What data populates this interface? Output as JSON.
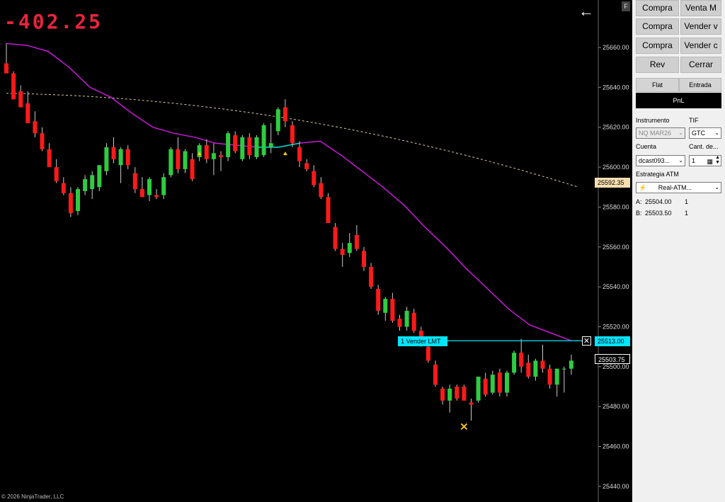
{
  "chart": {
    "pnl_display": "-402.25",
    "copyright": "© 2026 NinjaTrader, LLC",
    "y_ticks": [
      "25660.00",
      "25640.00",
      "25620.00",
      "25600.00",
      "25580.00",
      "25560.00",
      "25540.00",
      "25520.00",
      "25500.00",
      "25480.00",
      "25460.00",
      "25440.00"
    ],
    "price_tags": {
      "dashed_ma": "25592.35",
      "order": "25513.00",
      "last": "25503.75"
    },
    "order_label": "1  Vender LMT",
    "colors": {
      "bull": "#2ecc40",
      "bear": "#ff1a1a",
      "ma_fast": "#c818d8",
      "ma_fast_tail": "#00e5e5",
      "ma_slow": "#d9c9a0",
      "order_line": "#00e5ff"
    }
  },
  "chart_data": {
    "type": "candlestick",
    "ylim": [
      25434,
      25670
    ],
    "candles": [
      {
        "o": 25652,
        "h": 25662,
        "l": 25647,
        "c": 25647
      },
      {
        "o": 25647,
        "h": 25648,
        "l": 25634,
        "c": 25634
      },
      {
        "o": 25638,
        "h": 25641,
        "l": 25630,
        "c": 25630
      },
      {
        "o": 25632,
        "h": 25638,
        "l": 25622,
        "c": 25622
      },
      {
        "o": 25623,
        "h": 25628,
        "l": 25615,
        "c": 25617
      },
      {
        "o": 25617,
        "h": 25620,
        "l": 25608,
        "c": 25609
      },
      {
        "o": 25609,
        "h": 25612,
        "l": 25600,
        "c": 25600
      },
      {
        "o": 25600,
        "h": 25604,
        "l": 25592,
        "c": 25593
      },
      {
        "o": 25592,
        "h": 25595,
        "l": 25586,
        "c": 25587
      },
      {
        "o": 25587,
        "h": 25590,
        "l": 25575,
        "c": 25577
      },
      {
        "o": 25578,
        "h": 25590,
        "l": 25576,
        "c": 25589
      },
      {
        "o": 25588,
        "h": 25596,
        "l": 25586,
        "c": 25594
      },
      {
        "o": 25589,
        "h": 25598,
        "l": 25584,
        "c": 25596
      },
      {
        "o": 25590,
        "h": 25601,
        "l": 25588,
        "c": 25601
      },
      {
        "o": 25598,
        "h": 25612,
        "l": 25596,
        "c": 25610
      },
      {
        "o": 25610,
        "h": 25615,
        "l": 25602,
        "c": 25604
      },
      {
        "o": 25601,
        "h": 25610,
        "l": 25592,
        "c": 25609
      },
      {
        "o": 25609,
        "h": 25611,
        "l": 25599,
        "c": 25601
      },
      {
        "o": 25597,
        "h": 25600,
        "l": 25587,
        "c": 25589
      },
      {
        "o": 25589,
        "h": 25595,
        "l": 25585,
        "c": 25585
      },
      {
        "o": 25586,
        "h": 25595,
        "l": 25583,
        "c": 25594
      },
      {
        "o": 25586,
        "h": 25589,
        "l": 25584,
        "c": 25585
      },
      {
        "o": 25586,
        "h": 25597,
        "l": 25584,
        "c": 25595
      },
      {
        "o": 25596,
        "h": 25610,
        "l": 25595,
        "c": 25609
      },
      {
        "o": 25609,
        "h": 25615,
        "l": 25597,
        "c": 25599
      },
      {
        "o": 25599,
        "h": 25609,
        "l": 25597,
        "c": 25608
      },
      {
        "o": 25604,
        "h": 25607,
        "l": 25593,
        "c": 25594
      },
      {
        "o": 25605,
        "h": 25612,
        "l": 25603,
        "c": 25611
      },
      {
        "o": 25611,
        "h": 25614,
        "l": 25602,
        "c": 25604
      },
      {
        "o": 25604,
        "h": 25612,
        "l": 25596,
        "c": 25607
      },
      {
        "o": 25606,
        "h": 25608,
        "l": 25598,
        "c": 25605
      },
      {
        "o": 25605,
        "h": 25618,
        "l": 25603,
        "c": 25617
      },
      {
        "o": 25616,
        "h": 25618,
        "l": 25607,
        "c": 25608
      },
      {
        "o": 25604,
        "h": 25616,
        "l": 25603,
        "c": 25615
      },
      {
        "o": 25615,
        "h": 25617,
        "l": 25604,
        "c": 25606
      },
      {
        "o": 25605,
        "h": 25616,
        "l": 25604,
        "c": 25615
      },
      {
        "o": 25606,
        "h": 25622,
        "l": 25605,
        "c": 25621
      },
      {
        "o": 25610,
        "h": 25622,
        "l": 25607,
        "c": 25612
      },
      {
        "o": 25618,
        "h": 25630,
        "l": 25616,
        "c": 25629
      },
      {
        "o": 25630,
        "h": 25634,
        "l": 25620,
        "c": 25623
      },
      {
        "o": 25621,
        "h": 25623,
        "l": 25610,
        "c": 25612
      },
      {
        "o": 25610,
        "h": 25613,
        "l": 25600,
        "c": 25603
      },
      {
        "o": 25602,
        "h": 25604,
        "l": 25598,
        "c": 25599
      },
      {
        "o": 25598,
        "h": 25601,
        "l": 25590,
        "c": 25591
      },
      {
        "o": 25592,
        "h": 25595,
        "l": 25584,
        "c": 25585
      },
      {
        "o": 25585,
        "h": 25587,
        "l": 25572,
        "c": 25572
      },
      {
        "o": 25570,
        "h": 25572,
        "l": 25558,
        "c": 25559
      },
      {
        "o": 25559,
        "h": 25562,
        "l": 25550,
        "c": 25556
      },
      {
        "o": 25557,
        "h": 25567,
        "l": 25555,
        "c": 25562
      },
      {
        "o": 25566,
        "h": 25571,
        "l": 25558,
        "c": 25559
      },
      {
        "o": 25558,
        "h": 25560,
        "l": 25548,
        "c": 25550
      },
      {
        "o": 25550,
        "h": 25552,
        "l": 25539,
        "c": 25540
      },
      {
        "o": 25539,
        "h": 25541,
        "l": 25526,
        "c": 25528
      },
      {
        "o": 25527,
        "h": 25535,
        "l": 25523,
        "c": 25534
      },
      {
        "o": 25534,
        "h": 25537,
        "l": 25522,
        "c": 25523
      },
      {
        "o": 25524,
        "h": 25526,
        "l": 25518,
        "c": 25520
      },
      {
        "o": 25520,
        "h": 25530,
        "l": 25518,
        "c": 25528
      },
      {
        "o": 25527,
        "h": 25529,
        "l": 25517,
        "c": 25518
      },
      {
        "o": 25518,
        "h": 25520,
        "l": 25510,
        "c": 25511
      },
      {
        "o": 25510,
        "h": 25512,
        "l": 25502,
        "c": 25503
      },
      {
        "o": 25501,
        "h": 25503,
        "l": 25490,
        "c": 25491
      },
      {
        "o": 25489,
        "h": 25490,
        "l": 25481,
        "c": 25483
      },
      {
        "o": 25483,
        "h": 25491,
        "l": 25477,
        "c": 25489
      },
      {
        "o": 25490,
        "h": 25491,
        "l": 25483,
        "c": 25484
      },
      {
        "o": 25490,
        "h": 25491,
        "l": 25483,
        "c": 25483
      },
      {
        "o": 25482,
        "h": 25484,
        "l": 25473,
        "c": 25481
      },
      {
        "o": 25483,
        "h": 25495,
        "l": 25482,
        "c": 25495
      },
      {
        "o": 25494,
        "h": 25497,
        "l": 25485,
        "c": 25486
      },
      {
        "o": 25487,
        "h": 25498,
        "l": 25486,
        "c": 25496
      },
      {
        "o": 25497,
        "h": 25499,
        "l": 25485,
        "c": 25487
      },
      {
        "o": 25487,
        "h": 25498,
        "l": 25485,
        "c": 25497
      },
      {
        "o": 25497,
        "h": 25508,
        "l": 25496,
        "c": 25507
      },
      {
        "o": 25507,
        "h": 25514,
        "l": 25497,
        "c": 25500
      },
      {
        "o": 25502,
        "h": 25506,
        "l": 25494,
        "c": 25495
      },
      {
        "o": 25495,
        "h": 25504,
        "l": 25493,
        "c": 25503
      },
      {
        "o": 25503,
        "h": 25511,
        "l": 25497,
        "c": 25499
      },
      {
        "o": 25499,
        "h": 25501,
        "l": 25489,
        "c": 25491
      },
      {
        "o": 25491,
        "h": 25499,
        "l": 25485,
        "c": 25499
      },
      {
        "o": 25499,
        "h": 25500,
        "l": 25487,
        "c": 25499
      },
      {
        "o": 25499,
        "h": 25506,
        "l": 25496,
        "c": 25503
      }
    ],
    "ma_fast": [
      [
        25662,
        25661
      ],
      [
        25658,
        25650
      ],
      [
        25640,
        25635
      ],
      [
        25627,
        25620
      ],
      [
        25617,
        25615
      ],
      [
        25612,
        25611
      ],
      [
        25610,
        25610
      ],
      [
        25612,
        25613
      ],
      [
        25606,
        25598
      ],
      [
        25590,
        25581
      ],
      [
        25570,
        25560
      ],
      [
        25549,
        25539
      ],
      [
        25529,
        25521
      ],
      [
        25517,
        25513
      ]
    ],
    "ma_slow": [
      [
        25637,
        25635
      ],
      [
        25626,
        25590
      ]
    ]
  },
  "panel": {
    "buttons": [
      "Compra",
      "Venta M",
      "Compra",
      "Vender v",
      "Compra",
      "Vender c",
      "Rev",
      "Cerrar"
    ],
    "tabs": {
      "flat": "Flat",
      "entrada": "Entrada",
      "pnl": "PnL"
    },
    "instrumento_label": "Instrumento",
    "instrumento_value": "NQ MAR26",
    "tif_label": "TIF",
    "tif_value": "GTC",
    "cuenta_label": "Cuenta",
    "cuenta_value": "dcast093...",
    "cant_label": "Cant. de...",
    "cant_value": "1",
    "atm_label": "Estrategia ATM",
    "atm_value": "Real-ATM...",
    "ask_label": "A:",
    "ask_price": "25504.00",
    "ask_qty": "1",
    "bid_label": "B:",
    "bid_price": "25503.50",
    "bid_qty": "1"
  }
}
